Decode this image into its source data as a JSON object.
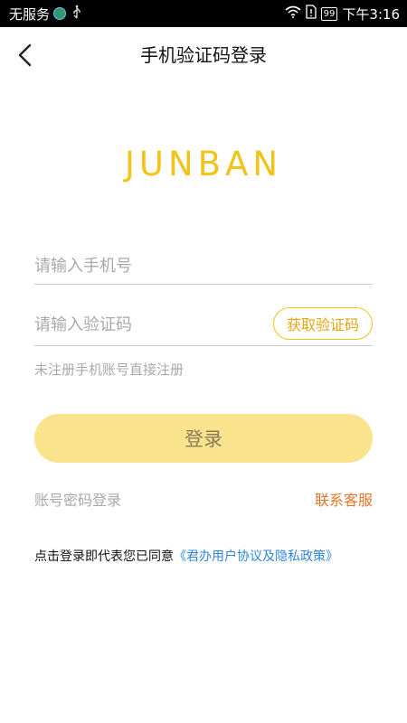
{
  "status_bar": {
    "carrier": "无服务",
    "battery": "99",
    "time": "下午3:16",
    "icons": [
      "green-dot-icon",
      "usb-icon",
      "wifi-icon",
      "sim-error-icon",
      "battery-icon"
    ]
  },
  "nav": {
    "title": "手机验证码登录",
    "back_icon": "chevron-left-icon"
  },
  "logo": "JUNBAN",
  "phone_input": {
    "placeholder": "请输入手机号",
    "value": ""
  },
  "code_input": {
    "placeholder": "请输入验证码",
    "value": ""
  },
  "get_code_label": "获取验证码",
  "hint": "未注册手机账号直接注册",
  "login_label": "登录",
  "password_login_label": "账号密码登录",
  "contact_label": "联系客服",
  "agreement": {
    "prefix": "点击登录即代表您已同意",
    "link": "《君办用户协议及隐私政策》"
  },
  "colors": {
    "brand": "#f2c318",
    "login_button": "#f9e38c",
    "contact": "#e0762a",
    "link": "#2e86d8"
  }
}
